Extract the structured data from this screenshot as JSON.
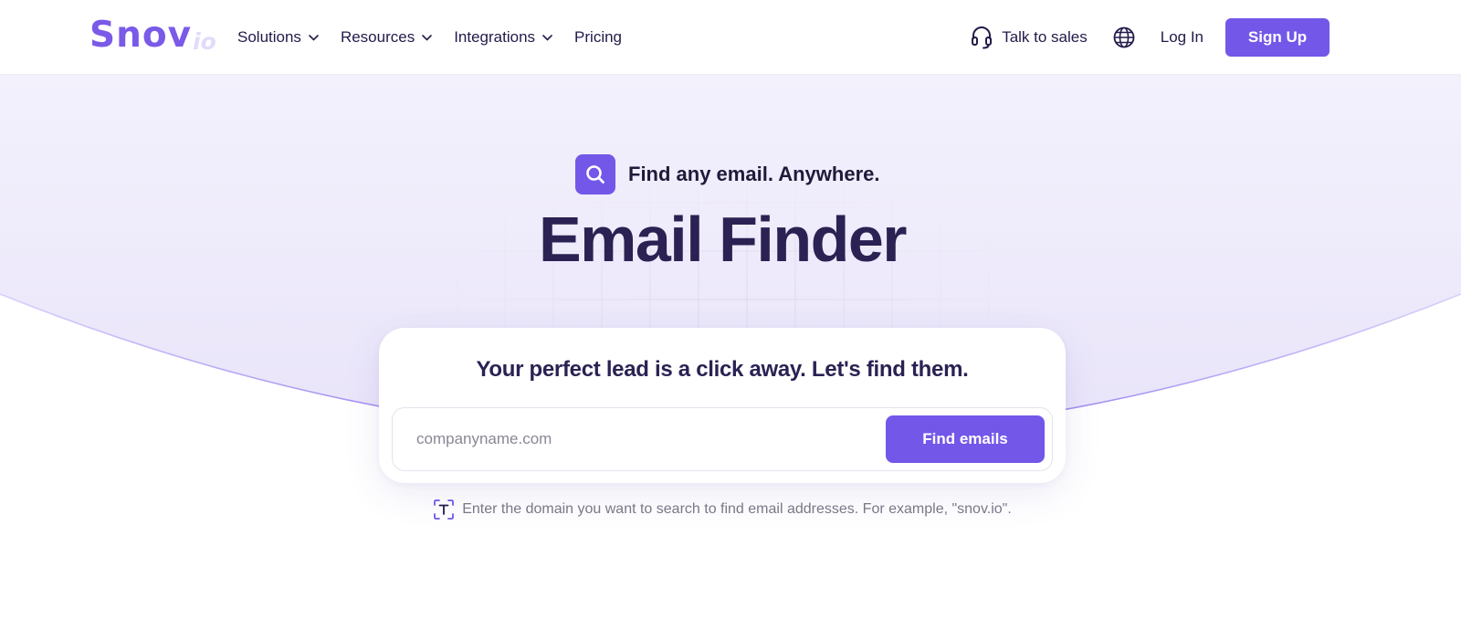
{
  "header": {
    "logo_main": "Snov",
    "logo_sub": "io",
    "nav": [
      {
        "label": "Solutions",
        "has_dropdown": true
      },
      {
        "label": "Resources",
        "has_dropdown": true
      },
      {
        "label": "Integrations",
        "has_dropdown": true
      },
      {
        "label": "Pricing",
        "has_dropdown": false
      }
    ],
    "talk_to_sales": "Talk to sales",
    "language_icon": "globe-icon",
    "login": "Log In",
    "signup": "Sign Up"
  },
  "hero": {
    "eyebrow_icon": "search-icon",
    "eyebrow": "Find any email. Anywhere.",
    "title": "Email Finder"
  },
  "search_card": {
    "title": "Your perfect lead is a click away. Let's find them.",
    "input_placeholder": "companyname.com",
    "input_value": "",
    "button": "Find emails"
  },
  "hint": {
    "icon": "text-scan-icon",
    "text": "Enter the domain you want to search to find email addresses. For example, \"snov.io\"."
  },
  "colors": {
    "brand": "#7357e8",
    "heading": "#2b2253",
    "hero_bg": "#f1eefb",
    "curve_line": "#9c85f0"
  }
}
